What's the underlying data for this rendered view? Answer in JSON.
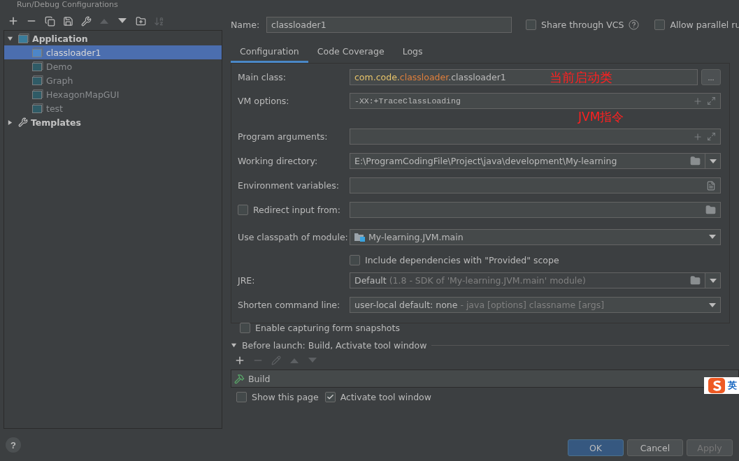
{
  "window": {
    "title": "Run/Debug Configurations"
  },
  "toolbar": [
    {
      "kind": "add",
      "disabled": false
    },
    {
      "kind": "remove",
      "disabled": false
    },
    {
      "kind": "copy",
      "disabled": false
    },
    {
      "kind": "save",
      "disabled": false
    },
    {
      "kind": "wrench",
      "disabled": false
    },
    {
      "kind": "up",
      "disabled": true
    },
    {
      "kind": "down",
      "disabled": false
    },
    {
      "kind": "folder",
      "disabled": false
    },
    {
      "kind": "sort",
      "disabled": true
    }
  ],
  "tree": [
    {
      "label": "Application",
      "kind": "group",
      "expanded": true,
      "selected": false,
      "children": [
        {
          "label": "classloader1",
          "kind": "config",
          "selected": true
        },
        {
          "label": "Demo",
          "kind": "config",
          "selected": false
        },
        {
          "label": "Graph",
          "kind": "config",
          "selected": false
        },
        {
          "label": "HexagonMapGUI",
          "kind": "config",
          "selected": false
        },
        {
          "label": "test",
          "kind": "config",
          "selected": false
        }
      ]
    },
    {
      "label": "Templates",
      "kind": "templates",
      "expanded": false,
      "selected": false
    }
  ],
  "name": {
    "label": "Name:",
    "value": "classloader1"
  },
  "options": [
    {
      "label": "Share through VCS",
      "checked": false,
      "help": true
    },
    {
      "label": "Allow parallel ru",
      "checked": false
    }
  ],
  "tabs": [
    {
      "label": "Configuration",
      "selected": true
    },
    {
      "label": "Code Coverage",
      "selected": false
    },
    {
      "label": "Logs",
      "selected": false
    }
  ],
  "form": [
    {
      "kind": "field",
      "label": "Main class:",
      "value_parts": [
        {
          "text": "com.code.",
          "kind": "package"
        },
        {
          "text": "classloader",
          "kind": "highlight"
        },
        {
          "text": ".classloader1",
          "kind": "plain"
        }
      ],
      "browse": "...",
      "annotation": "当前启动类"
    },
    {
      "kind": "field",
      "label": "VM options:",
      "value": "-XX:+TraceClassLoading",
      "mono": true,
      "trail": [
        {
          "kind": "plus"
        },
        {
          "kind": "expand"
        }
      ],
      "annotation_below": "JVM指令"
    },
    {
      "kind": "field",
      "label": "Program arguments:",
      "trail": [
        {
          "kind": "plus"
        },
        {
          "kind": "expand"
        }
      ]
    },
    {
      "kind": "field",
      "label": "Working directory:",
      "value": "E:\\ProgramCodingFile\\Project\\java\\development\\My-learning",
      "trail": [
        {
          "kind": "folder"
        }
      ],
      "dropdown": true
    },
    {
      "kind": "field",
      "label": "Environment variables:",
      "trail": [
        {
          "kind": "list"
        }
      ]
    },
    {
      "kind": "checkfield",
      "label": "Redirect input from:",
      "checked": false,
      "trail": [
        {
          "kind": "folder"
        }
      ]
    },
    {
      "kind": "select",
      "label": "Use classpath of module:",
      "value": "My-learning.JVM.main",
      "module_icon": true
    },
    {
      "kind": "subcheck",
      "label": "Include dependencies with \"Provided\" scope",
      "checked": false
    },
    {
      "kind": "select",
      "label": "JRE:",
      "value": "Default",
      "hint": " (1.8 - SDK of 'My-learning.JVM.main' module)",
      "muted": true,
      "trail": [
        {
          "kind": "folder"
        }
      ],
      "split": true
    },
    {
      "kind": "select",
      "label": "Shorten command line:",
      "value": "user-local default: none",
      "hint": " - java [options] classname [args]"
    },
    {
      "kind": "check",
      "label": "Enable capturing form snapshots",
      "checked": false
    }
  ],
  "before_launch": {
    "title": "Before launch: Build, Activate tool window",
    "expanded": true,
    "toolbar": [
      {
        "kind": "add",
        "disabled": false
      },
      {
        "kind": "remove",
        "disabled": true
      },
      {
        "kind": "edit",
        "disabled": true
      },
      {
        "kind": "up",
        "disabled": true
      },
      {
        "kind": "down",
        "disabled": true
      }
    ],
    "tasks": [
      {
        "label": "Build"
      }
    ],
    "options": [
      {
        "label": "Show this page",
        "checked": false
      },
      {
        "label": "Activate tool window",
        "checked": true
      }
    ]
  },
  "ime": {
    "label": "英"
  },
  "help_button": {
    "label": "?"
  },
  "buttons": [
    {
      "label": "OK",
      "primary": true,
      "disabled": false
    },
    {
      "label": "Cancel",
      "primary": false,
      "disabled": false
    },
    {
      "label": "Apply",
      "primary": false,
      "disabled": true
    }
  ]
}
